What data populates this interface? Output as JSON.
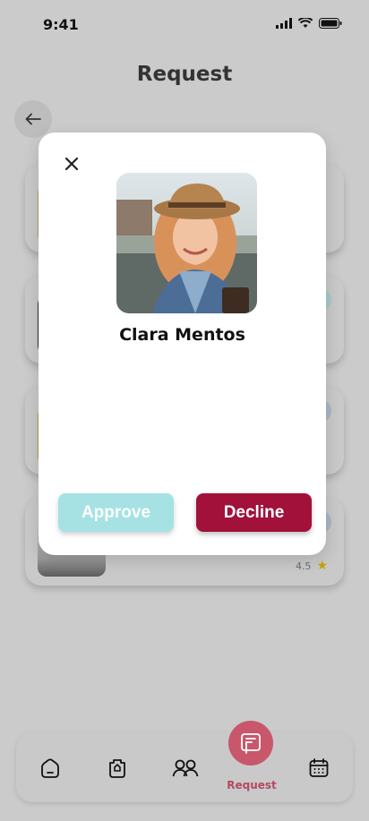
{
  "status": {
    "time": "9:41"
  },
  "header": {
    "title": "Request"
  },
  "background_cards": [
    {
      "rating": ""
    },
    {
      "rating": ""
    },
    {
      "rating": ""
    },
    {
      "rating": "4.5"
    }
  ],
  "modal": {
    "name": "Clara Mentos",
    "approve_label": "Approve",
    "decline_label": "Decline"
  },
  "nav": {
    "items": [
      "home-icon",
      "bag-icon",
      "people-icon",
      "request-icon",
      "calendar-icon"
    ],
    "active_label": "Request"
  },
  "colors": {
    "approve": "#a6e2e3",
    "decline": "#a1113a",
    "nav_active": "#c8576c"
  }
}
